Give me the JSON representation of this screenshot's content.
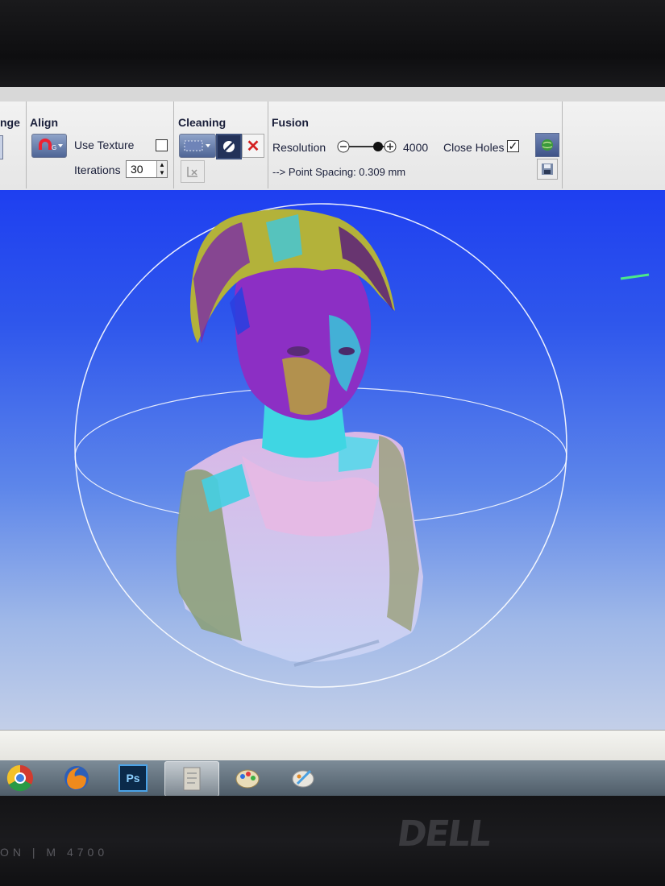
{
  "ribbon": {
    "range_fragment": "nge",
    "align": {
      "title": "Align",
      "use_texture_label": "Use Texture",
      "use_texture_checked": false,
      "iterations_label": "Iterations",
      "iterations_value": "30"
    },
    "cleaning": {
      "title": "Cleaning"
    },
    "fusion": {
      "title": "Fusion",
      "resolution_label": "Resolution",
      "resolution_value": "4000",
      "close_holes_label": "Close Holes",
      "close_holes_checked": true,
      "point_spacing": "--> Point Spacing: 0.309 mm"
    }
  },
  "viewport": {
    "model": "3D scanned bust with deviation color map",
    "colors": {
      "bg_top": "#1e3ff0",
      "bg_bottom": "#c3cfe8"
    }
  },
  "taskbar": {
    "items": [
      {
        "name": "chrome-icon"
      },
      {
        "name": "firefox-icon"
      },
      {
        "name": "photoshop-icon",
        "label": "Ps"
      },
      {
        "name": "scanner-app-icon",
        "active": true
      },
      {
        "name": "paint-icon"
      },
      {
        "name": "paint-brush-icon"
      }
    ]
  },
  "monitor": {
    "brand": "DELL",
    "model": "ON | M 4700"
  }
}
